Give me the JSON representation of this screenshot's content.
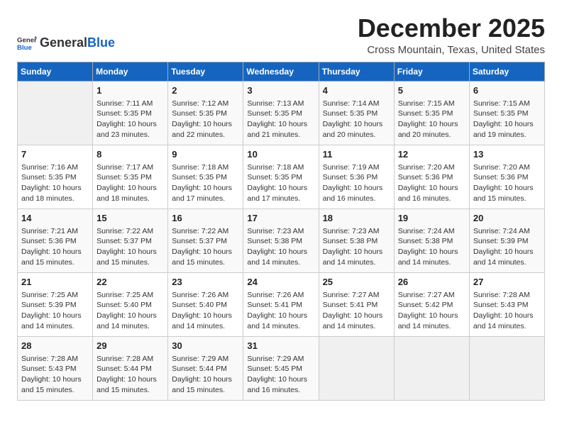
{
  "logo": {
    "general": "General",
    "blue": "Blue"
  },
  "header": {
    "title": "December 2025",
    "subtitle": "Cross Mountain, Texas, United States"
  },
  "calendar": {
    "days_of_week": [
      "Sunday",
      "Monday",
      "Tuesday",
      "Wednesday",
      "Thursday",
      "Friday",
      "Saturday"
    ],
    "weeks": [
      [
        {
          "day": "",
          "data": ""
        },
        {
          "day": "1",
          "data": "Sunrise: 7:11 AM\nSunset: 5:35 PM\nDaylight: 10 hours\nand 23 minutes."
        },
        {
          "day": "2",
          "data": "Sunrise: 7:12 AM\nSunset: 5:35 PM\nDaylight: 10 hours\nand 22 minutes."
        },
        {
          "day": "3",
          "data": "Sunrise: 7:13 AM\nSunset: 5:35 PM\nDaylight: 10 hours\nand 21 minutes."
        },
        {
          "day": "4",
          "data": "Sunrise: 7:14 AM\nSunset: 5:35 PM\nDaylight: 10 hours\nand 20 minutes."
        },
        {
          "day": "5",
          "data": "Sunrise: 7:15 AM\nSunset: 5:35 PM\nDaylight: 10 hours\nand 20 minutes."
        },
        {
          "day": "6",
          "data": "Sunrise: 7:15 AM\nSunset: 5:35 PM\nDaylight: 10 hours\nand 19 minutes."
        }
      ],
      [
        {
          "day": "7",
          "data": "Sunrise: 7:16 AM\nSunset: 5:35 PM\nDaylight: 10 hours\nand 18 minutes."
        },
        {
          "day": "8",
          "data": "Sunrise: 7:17 AM\nSunset: 5:35 PM\nDaylight: 10 hours\nand 18 minutes."
        },
        {
          "day": "9",
          "data": "Sunrise: 7:18 AM\nSunset: 5:35 PM\nDaylight: 10 hours\nand 17 minutes."
        },
        {
          "day": "10",
          "data": "Sunrise: 7:18 AM\nSunset: 5:35 PM\nDaylight: 10 hours\nand 17 minutes."
        },
        {
          "day": "11",
          "data": "Sunrise: 7:19 AM\nSunset: 5:36 PM\nDaylight: 10 hours\nand 16 minutes."
        },
        {
          "day": "12",
          "data": "Sunrise: 7:20 AM\nSunset: 5:36 PM\nDaylight: 10 hours\nand 16 minutes."
        },
        {
          "day": "13",
          "data": "Sunrise: 7:20 AM\nSunset: 5:36 PM\nDaylight: 10 hours\nand 15 minutes."
        }
      ],
      [
        {
          "day": "14",
          "data": "Sunrise: 7:21 AM\nSunset: 5:36 PM\nDaylight: 10 hours\nand 15 minutes."
        },
        {
          "day": "15",
          "data": "Sunrise: 7:22 AM\nSunset: 5:37 PM\nDaylight: 10 hours\nand 15 minutes."
        },
        {
          "day": "16",
          "data": "Sunrise: 7:22 AM\nSunset: 5:37 PM\nDaylight: 10 hours\nand 15 minutes."
        },
        {
          "day": "17",
          "data": "Sunrise: 7:23 AM\nSunset: 5:38 PM\nDaylight: 10 hours\nand 14 minutes."
        },
        {
          "day": "18",
          "data": "Sunrise: 7:23 AM\nSunset: 5:38 PM\nDaylight: 10 hours\nand 14 minutes."
        },
        {
          "day": "19",
          "data": "Sunrise: 7:24 AM\nSunset: 5:38 PM\nDaylight: 10 hours\nand 14 minutes."
        },
        {
          "day": "20",
          "data": "Sunrise: 7:24 AM\nSunset: 5:39 PM\nDaylight: 10 hours\nand 14 minutes."
        }
      ],
      [
        {
          "day": "21",
          "data": "Sunrise: 7:25 AM\nSunset: 5:39 PM\nDaylight: 10 hours\nand 14 minutes."
        },
        {
          "day": "22",
          "data": "Sunrise: 7:25 AM\nSunset: 5:40 PM\nDaylight: 10 hours\nand 14 minutes."
        },
        {
          "day": "23",
          "data": "Sunrise: 7:26 AM\nSunset: 5:40 PM\nDaylight: 10 hours\nand 14 minutes."
        },
        {
          "day": "24",
          "data": "Sunrise: 7:26 AM\nSunset: 5:41 PM\nDaylight: 10 hours\nand 14 minutes."
        },
        {
          "day": "25",
          "data": "Sunrise: 7:27 AM\nSunset: 5:41 PM\nDaylight: 10 hours\nand 14 minutes."
        },
        {
          "day": "26",
          "data": "Sunrise: 7:27 AM\nSunset: 5:42 PM\nDaylight: 10 hours\nand 14 minutes."
        },
        {
          "day": "27",
          "data": "Sunrise: 7:28 AM\nSunset: 5:43 PM\nDaylight: 10 hours\nand 14 minutes."
        }
      ],
      [
        {
          "day": "28",
          "data": "Sunrise: 7:28 AM\nSunset: 5:43 PM\nDaylight: 10 hours\nand 15 minutes."
        },
        {
          "day": "29",
          "data": "Sunrise: 7:28 AM\nSunset: 5:44 PM\nDaylight: 10 hours\nand 15 minutes."
        },
        {
          "day": "30",
          "data": "Sunrise: 7:29 AM\nSunset: 5:44 PM\nDaylight: 10 hours\nand 15 minutes."
        },
        {
          "day": "31",
          "data": "Sunrise: 7:29 AM\nSunset: 5:45 PM\nDaylight: 10 hours\nand 16 minutes."
        },
        {
          "day": "",
          "data": ""
        },
        {
          "day": "",
          "data": ""
        },
        {
          "day": "",
          "data": ""
        }
      ]
    ]
  }
}
